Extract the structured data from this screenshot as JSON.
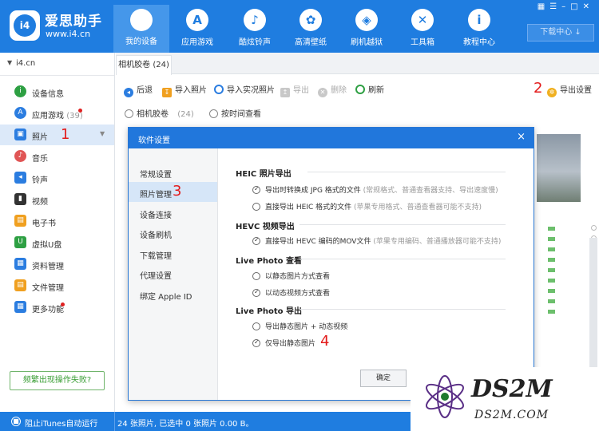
{
  "app": {
    "name": "爱思助手",
    "url": "www.i4.cn",
    "logo": "i4"
  },
  "nav": [
    {
      "label": "我的设备",
      "icon": "apple-icon",
      "glyph": "",
      "active": true
    },
    {
      "label": "应用游戏",
      "icon": "app-store-icon",
      "glyph": "A"
    },
    {
      "label": "酷炫铃声",
      "icon": "bell-icon",
      "glyph": "♪"
    },
    {
      "label": "高清壁纸",
      "icon": "flower-icon",
      "glyph": "✿"
    },
    {
      "label": "刷机越狱",
      "icon": "box-icon",
      "glyph": "◈"
    },
    {
      "label": "工具箱",
      "icon": "tools-icon",
      "glyph": "✕"
    },
    {
      "label": "教程中心",
      "icon": "info-icon",
      "glyph": "i"
    }
  ],
  "download_center": "下载中心 ↓",
  "device": "i4.cn",
  "sidebar": [
    {
      "label": "设备信息",
      "color": "#2ea043",
      "glyph": "i"
    },
    {
      "label": "应用游戏",
      "count": "(39)",
      "color": "#2b7de0",
      "glyph": "A",
      "badge": true
    },
    {
      "label": "照片",
      "color": "#2b7de0",
      "glyph": "▣",
      "active": true
    },
    {
      "label": "音乐",
      "color": "#e05555",
      "glyph": "♪"
    },
    {
      "label": "铃声",
      "color": "#2b7de0",
      "glyph": "◂"
    },
    {
      "label": "视频",
      "color": "#333333",
      "glyph": "▮"
    },
    {
      "label": "电子书",
      "color": "#f0a020",
      "glyph": "▤"
    },
    {
      "label": "虚拟U盘",
      "color": "#2ea043",
      "glyph": "U"
    },
    {
      "label": "资料管理",
      "color": "#2b7de0",
      "glyph": "▦"
    },
    {
      "label": "文件管理",
      "color": "#f0a020",
      "glyph": "▤"
    },
    {
      "label": "更多功能",
      "color": "#2b7de0",
      "glyph": "▦",
      "badge": true
    }
  ],
  "report_button": "频繁出现操作失败?",
  "status": {
    "itunes": "阻止iTunes自动运行",
    "info": "24 张照片, 已选中 0 张照片 0.00 B。"
  },
  "tab": "相机胶卷 (24)",
  "toolbar": {
    "back": "后退",
    "import_photos": "导入照片",
    "import_live": "导入实况照片",
    "export": "导出",
    "delete": "删除",
    "refresh": "刷新",
    "export_settings": "导出设置"
  },
  "view": {
    "camera_roll": "相机胶卷",
    "camera_roll_count": "(24)",
    "by_time": "按时间查看"
  },
  "steps": [
    "1",
    "2",
    "3",
    "4"
  ],
  "dialog": {
    "title": "软件设置",
    "close": "×",
    "nav": [
      "常规设置",
      "照片管理",
      "设备连接",
      "设备刷机",
      "下载管理",
      "代理设置",
      "绑定 Apple ID"
    ],
    "sections": {
      "heic": {
        "title": "HEIC 照片导出",
        "opt1": "导出时转换成 JPG 格式的文件",
        "opt1_note": "(常规格式、普通查看器支持、导出速度慢)",
        "opt2": "直接导出 HEIC 格式的文件",
        "opt2_note": "(苹果专用格式、普通查看器可能不支持)"
      },
      "hevc": {
        "title": "HEVC 视频导出",
        "opt1": "直接导出 HEVC 编码的MOV文件",
        "opt1_note": "(苹果专用编码、普通播放器可能不支持)"
      },
      "live_view": {
        "title": "Live Photo 查看",
        "opt1": "以静态图片方式查看",
        "opt2": "以动态视频方式查看"
      },
      "live_export": {
        "title": "Live Photo 导出",
        "opt1": "导出静态图片 + 动态视频",
        "opt2": "仅导出静态图片"
      }
    },
    "ok": "确定"
  },
  "watermark": {
    "brand": "DS2M",
    "url": "DS2M.COM"
  }
}
